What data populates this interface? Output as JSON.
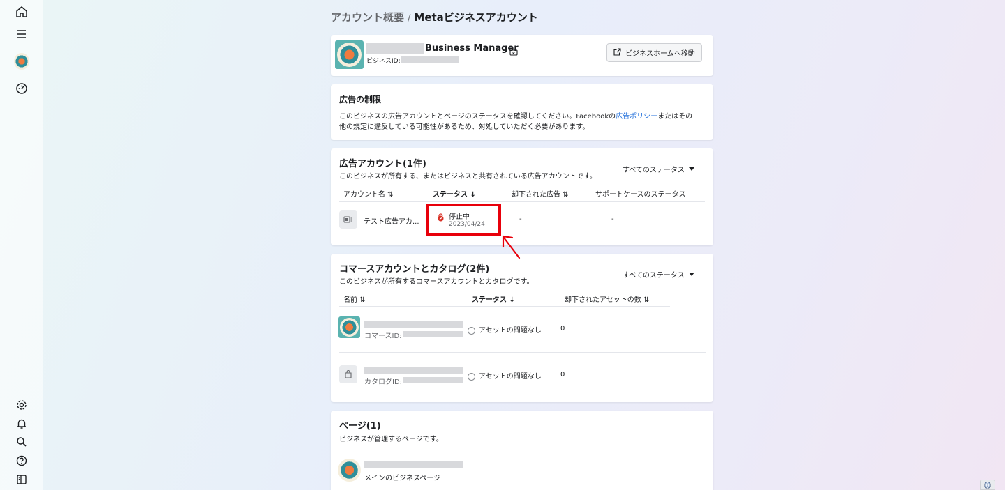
{
  "breadcrumb": {
    "parent": "アカウント概要",
    "separator": "/",
    "current": "Metaビジネスアカウント"
  },
  "business": {
    "name_suffix": "Business Manager",
    "id_label": "ビジネスID:",
    "home_button": "ビジネスホームへ移動"
  },
  "ad_limits": {
    "title": "広告の制限",
    "text_before_link": "このビジネスの広告アカウントとページのステータスを確認してください。Facebookの",
    "link": "広告ポリシー",
    "text_after_link": "またはその",
    "text_line2": "他の規定に違反している可能性があるため、対処していただく必要があります。"
  },
  "ad_accounts": {
    "title": "広告アカウント(1件)",
    "subtitle": "このビジネスが所有する、またはビジネスと共有されている広告アカウントです。",
    "filter": "すべてのステータス",
    "columns": [
      "アカウント名 ⇅",
      "ステータス ↓",
      "却下された広告 ⇅",
      "サポートケースのステータス"
    ],
    "rows": [
      {
        "name": "テスト広告アカ...",
        "status": "停止中",
        "status_date": "2023/04/24",
        "rejected_ads": "-",
        "support_status": "-"
      }
    ]
  },
  "commerce": {
    "title": "コマースアカウントとカタログ(2件)",
    "subtitle": "このビジネスが所有するコマースアカウントとカタログです。",
    "filter": "すべてのステータス",
    "columns": [
      "名前 ⇅",
      "ステータス ↓",
      "却下されたアセットの数 ⇅"
    ],
    "rows": [
      {
        "id_label": "コマースID:",
        "status": "アセットの問題なし",
        "count": "0"
      },
      {
        "id_label": "カタログID:",
        "status": "アセットの問題なし",
        "count": "0"
      }
    ]
  },
  "pages": {
    "title": "ページ(1)",
    "subtitle": "ビジネスが管理するページです。",
    "rows": [
      {
        "label": "メインのビジネスページ"
      }
    ]
  },
  "colors": {
    "highlight": "#e8000b",
    "link": "#216fdb",
    "suspended": "#d93025"
  },
  "icons": {
    "sidebar": [
      "home-icon",
      "menu-icon",
      "business-avatar",
      "dashboard-icon",
      "settings-icon",
      "bell-icon",
      "search-icon",
      "help-icon",
      "panel-icon"
    ]
  }
}
